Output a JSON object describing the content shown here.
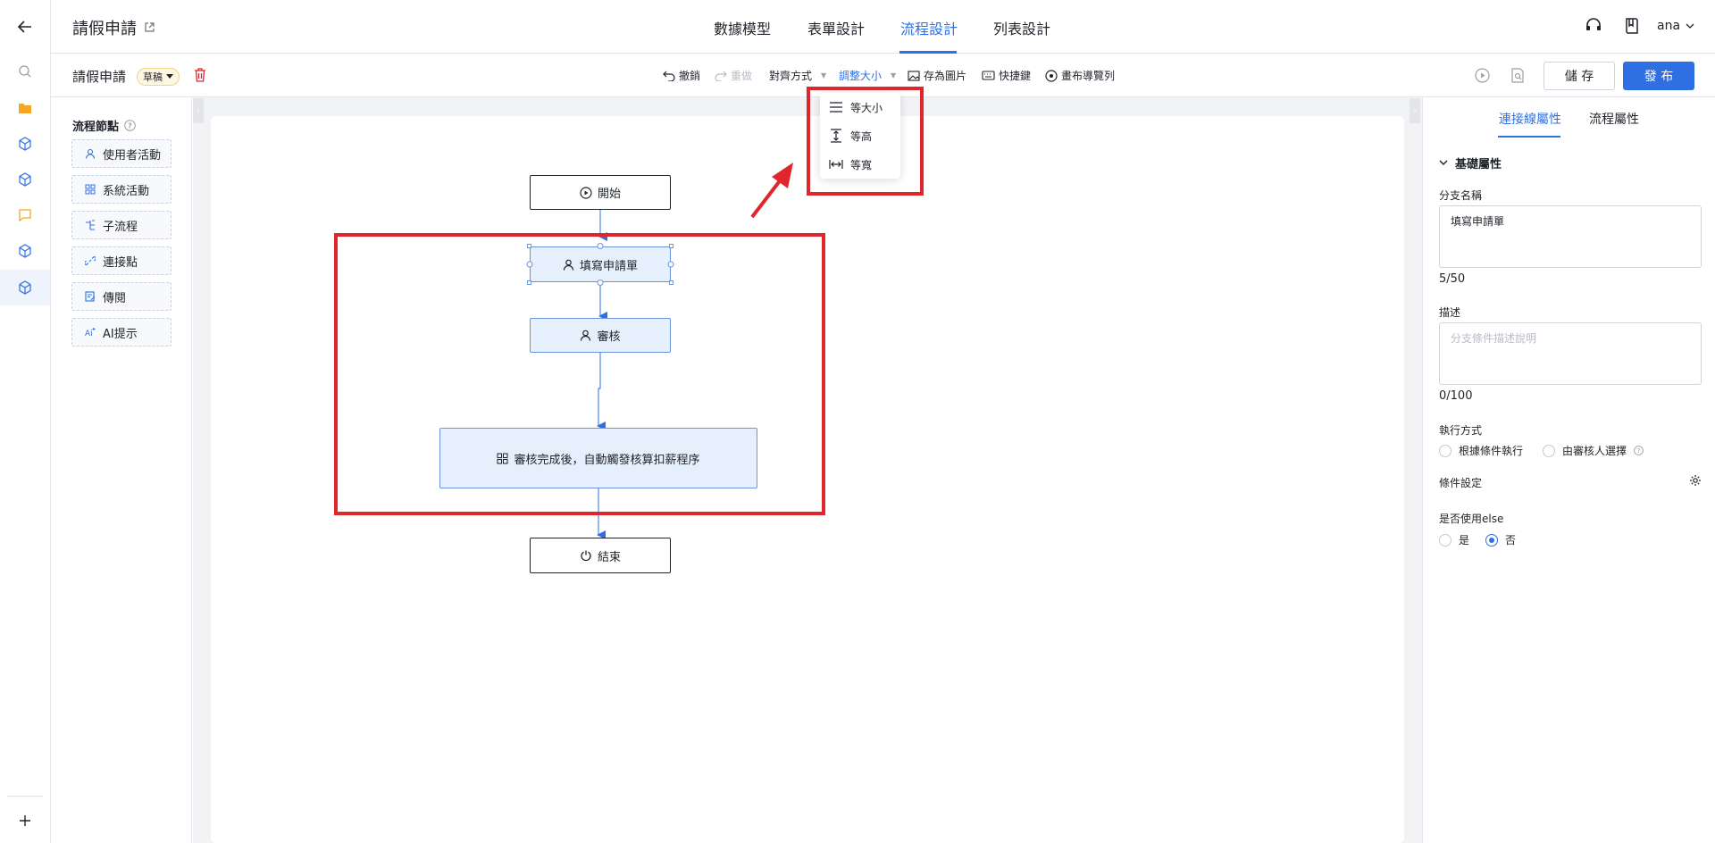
{
  "header": {
    "title": "請假申請",
    "tabs": [
      {
        "label": "數據模型",
        "active": false
      },
      {
        "label": "表單設計",
        "active": false
      },
      {
        "label": "流程設計",
        "active": true
      },
      {
        "label": "列表設計",
        "active": false
      }
    ],
    "user": "ana"
  },
  "toolbar": {
    "doc_title": "請假申請",
    "status_badge": "草稿",
    "undo": "撤銷",
    "redo": "重做",
    "align": "對齊方式",
    "resize": "調整大小",
    "save_image": "存為圖片",
    "shortcuts": "快捷鍵",
    "canvas_nav": "畫布導覽列",
    "save": "儲 存",
    "publish": "發 布"
  },
  "palette": {
    "title": "流程節點",
    "items": [
      {
        "label": "使用者活動",
        "icon": "user-icon"
      },
      {
        "label": "系統活動",
        "icon": "grid-icon"
      },
      {
        "label": "子流程",
        "icon": "subflow-icon"
      },
      {
        "label": "連接點",
        "icon": "link-icon"
      },
      {
        "label": "傳閱",
        "icon": "circulate-icon"
      },
      {
        "label": "AI提示",
        "icon": "ai-icon"
      }
    ]
  },
  "resize_menu": {
    "items": [
      {
        "label": "等大小",
        "icon": "equal-size-icon"
      },
      {
        "label": "等高",
        "icon": "equal-height-icon"
      },
      {
        "label": "等寬",
        "icon": "equal-width-icon"
      }
    ]
  },
  "flow": {
    "start": "開始",
    "fill_form": "填寫申請單",
    "review": "審核",
    "auto_calc": "審核完成後，自動觸發核算扣薪程序",
    "end": "結束"
  },
  "properties": {
    "tabs": [
      "連接線屬性",
      "流程屬性"
    ],
    "section": "基礎屬性",
    "branch_name_label": "分支名稱",
    "branch_name_value": "填寫申請單",
    "branch_name_count": "5/50",
    "desc_label": "描述",
    "desc_placeholder": "分支條件描述說明",
    "desc_count": "0/100",
    "exec_label": "執行方式",
    "exec_options": [
      "根據條件執行",
      "由審核人選擇"
    ],
    "condition_label": "條件設定",
    "else_label": "是否使用else",
    "else_options": [
      "是",
      "否"
    ],
    "else_selected": "否"
  },
  "colors": {
    "accent": "#2f6fe4",
    "annotation": "#e0262c",
    "task_fill": "#e6effc"
  }
}
